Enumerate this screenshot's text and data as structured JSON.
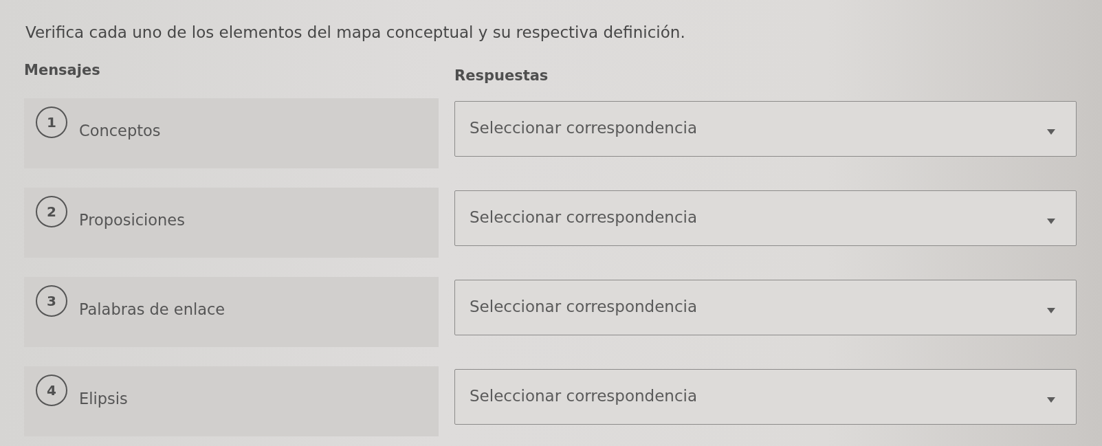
{
  "instruction": "Verifica cada uno de los elementos del mapa conceptual y su respectiva definición.",
  "headings": {
    "messages": "Mensajes",
    "answers": "Respuestas"
  },
  "items": [
    {
      "number": "1",
      "message": "Conceptos",
      "answer": {
        "placeholder": "Seleccionar correspondencia"
      }
    },
    {
      "number": "2",
      "message": "Proposiciones",
      "answer": {
        "placeholder": "Seleccionar correspondencia"
      }
    },
    {
      "number": "3",
      "message": "Palabras de enlace",
      "answer": {
        "placeholder": "Seleccionar correspondencia"
      }
    },
    {
      "number": "4",
      "message": "Elipsis",
      "answer": {
        "placeholder": "Seleccionar correspondencia"
      }
    }
  ]
}
